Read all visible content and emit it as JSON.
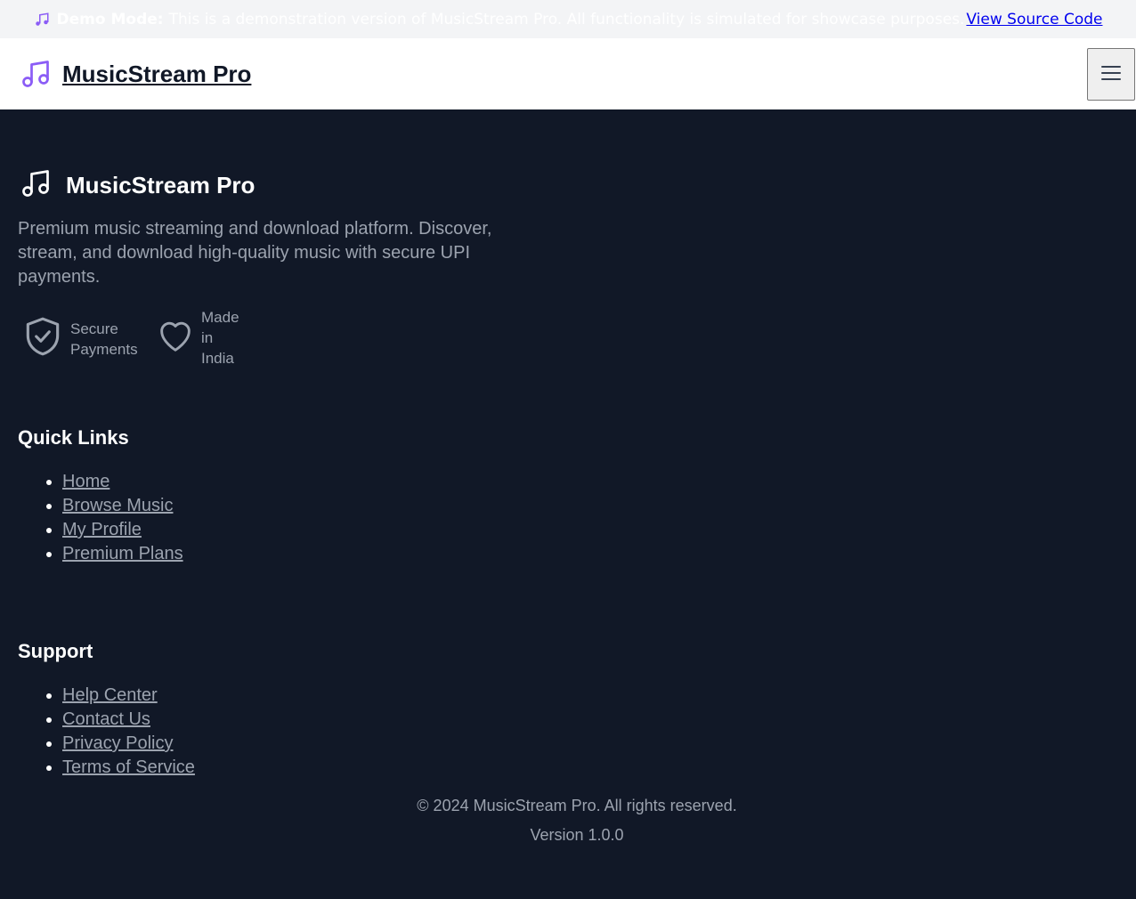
{
  "banner": {
    "icon": "music-note-icon",
    "strong_label": "Demo Mode:",
    "text": "This is a demonstration version of MusicStream Pro. All functionality is simulated for showcase purposes.",
    "link_label": "View Source Code"
  },
  "header": {
    "logo_icon": "music-note-icon",
    "brand": "MusicStream Pro",
    "menu_icon": "hamburger-menu-icon"
  },
  "footer": {
    "brand": "MusicStream Pro",
    "description": "Premium music streaming and download platform. Discover, stream, and download high-quality music with secure UPI payments.",
    "badges": [
      {
        "icon": "shield-check-icon",
        "label": "Secure Payments"
      },
      {
        "icon": "heart-icon",
        "label": "Made in India"
      }
    ],
    "quick_links": {
      "title": "Quick Links",
      "items": [
        "Home",
        "Browse Music",
        "My Profile",
        "Premium Plans"
      ]
    },
    "support": {
      "title": "Support",
      "items": [
        "Help Center",
        "Contact Us",
        "Privacy Policy",
        "Terms of Service"
      ]
    },
    "copyright": "© 2024 MusicStream Pro. All rights reserved.",
    "version": "Version 1.0.0"
  },
  "colors": {
    "accent": "#8b5cf6",
    "footer_bg": "#111827",
    "muted_text": "#9ca3af"
  }
}
